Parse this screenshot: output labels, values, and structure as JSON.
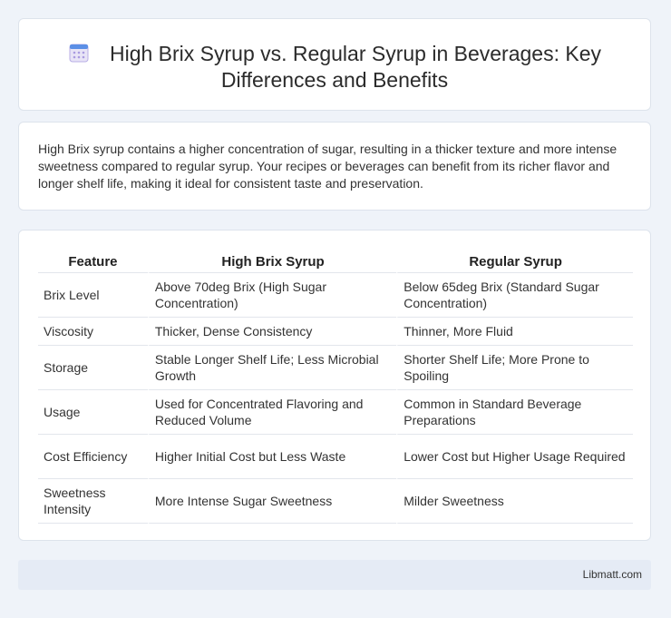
{
  "header": {
    "title": "High Brix Syrup vs. Regular Syrup in Beverages: Key Differences and Benefits",
    "icon": "calendar-icon"
  },
  "intro": {
    "text": "High Brix syrup contains a higher concentration of sugar, resulting in a thicker texture and more intense sweetness compared to regular syrup. Your recipes or beverages can benefit from its richer flavor and longer shelf life, making it ideal for consistent taste and preservation."
  },
  "table": {
    "headers": [
      "Feature",
      "High Brix Syrup",
      "Regular Syrup"
    ],
    "rows": [
      [
        "Brix Level",
        "Above 70deg Brix (High Sugar Concentration)",
        "Below 65deg Brix (Standard Sugar Concentration)"
      ],
      [
        "Viscosity",
        "Thicker, Dense Consistency",
        "Thinner, More Fluid"
      ],
      [
        "Storage",
        "Stable Longer Shelf Life; Less Microbial Growth",
        "Shorter Shelf Life; More Prone to Spoiling"
      ],
      [
        "Usage",
        "Used for Concentrated Flavoring and Reduced Volume",
        "Common in Standard Beverage Preparations"
      ],
      [
        "Cost Efficiency",
        "Higher Initial Cost but Less Waste",
        "Lower Cost but Higher Usage Required"
      ],
      [
        "Sweetness Intensity",
        "More Intense Sugar Sweetness",
        "Milder Sweetness"
      ]
    ]
  },
  "footer": {
    "text": "Libmatt.com"
  }
}
